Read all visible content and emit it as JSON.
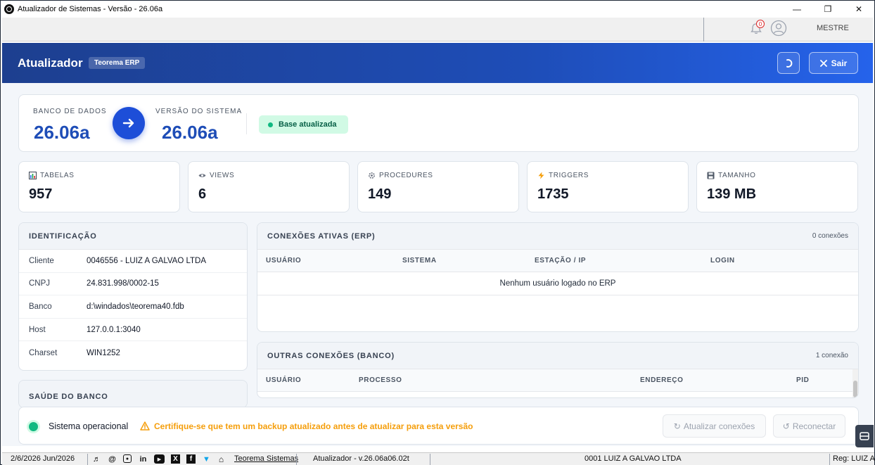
{
  "window": {
    "title": "Atualizador de Sistemas - Versão - 26.06a",
    "minimize": "—",
    "maximize": "❐",
    "close": "✕"
  },
  "topstrip": {
    "notification_count": "0",
    "user_name": "MESTRE"
  },
  "header": {
    "title": "Atualizador",
    "tag": "Teorema ERP",
    "exit_label": "Sair"
  },
  "version": {
    "db_label": "BANCO DE DADOS",
    "db_value": "26.06a",
    "sys_label": "VERSÃO DO SISTEMA",
    "sys_value": "26.06a",
    "status_badge": "Base atualizada"
  },
  "stats": {
    "tables": {
      "label": "TABELAS",
      "value": "957",
      "icon": "bar-chart-icon"
    },
    "views": {
      "label": "VIEWS",
      "value": "6",
      "icon": "eye-icon"
    },
    "procedures": {
      "label": "PROCEDURES",
      "value": "149",
      "icon": "gear-icon"
    },
    "triggers": {
      "label": "TRIGGERS",
      "value": "1735",
      "icon": "lightning-icon"
    },
    "size": {
      "label": "TAMANHO",
      "value": "139 MB",
      "icon": "disk-icon"
    }
  },
  "identification": {
    "title": "IDENTIFICAÇÃO",
    "rows": [
      {
        "key": "Cliente",
        "value": "0046556 - LUIZ A GALVAO LTDA"
      },
      {
        "key": "CNPJ",
        "value": "24.831.998/0002-15"
      },
      {
        "key": "Banco",
        "value": "d:\\windados\\teorema40.fdb"
      },
      {
        "key": "Host",
        "value": "127.0.0.1:3040"
      },
      {
        "key": "Charset",
        "value": "WIN1252"
      }
    ]
  },
  "health": {
    "title": "SAÚDE DO BANCO"
  },
  "active_connections": {
    "title": "CONEXÕES ATIVAS (ERP)",
    "count": "0 conexões",
    "columns": [
      "USUÁRIO",
      "SISTEMA",
      "ESTAÇÃO / IP",
      "LOGIN"
    ],
    "empty_message": "Nenhum usuário logado no ERP"
  },
  "other_connections": {
    "title": "OUTRAS CONEXÕES (BANCO)",
    "count": "1 conexão",
    "columns": [
      "USUÁRIO",
      "PROCESSO",
      "ENDEREÇO",
      "PID"
    ]
  },
  "status": {
    "text": "Sistema operacional",
    "warning": "Certifique-se que tem um backup atualizado antes de atualizar para esta versão",
    "refresh_connections": "Atualizar conexões",
    "reconnect": "Reconectar"
  },
  "footer": {
    "date": "2/6/2026 Jun/2026",
    "company_link": "Teorema Sistemas",
    "version": "Atualizador - v.26.06a06.02t",
    "client": "0001 LUIZ A GALVAO LTDA",
    "reg": "Reg: LUIZ A"
  },
  "colors": {
    "header_blue": "#1e4db7",
    "accent_blue": "#1d4ed8",
    "success_green": "#10b981",
    "warning_orange": "#f59e0b"
  }
}
